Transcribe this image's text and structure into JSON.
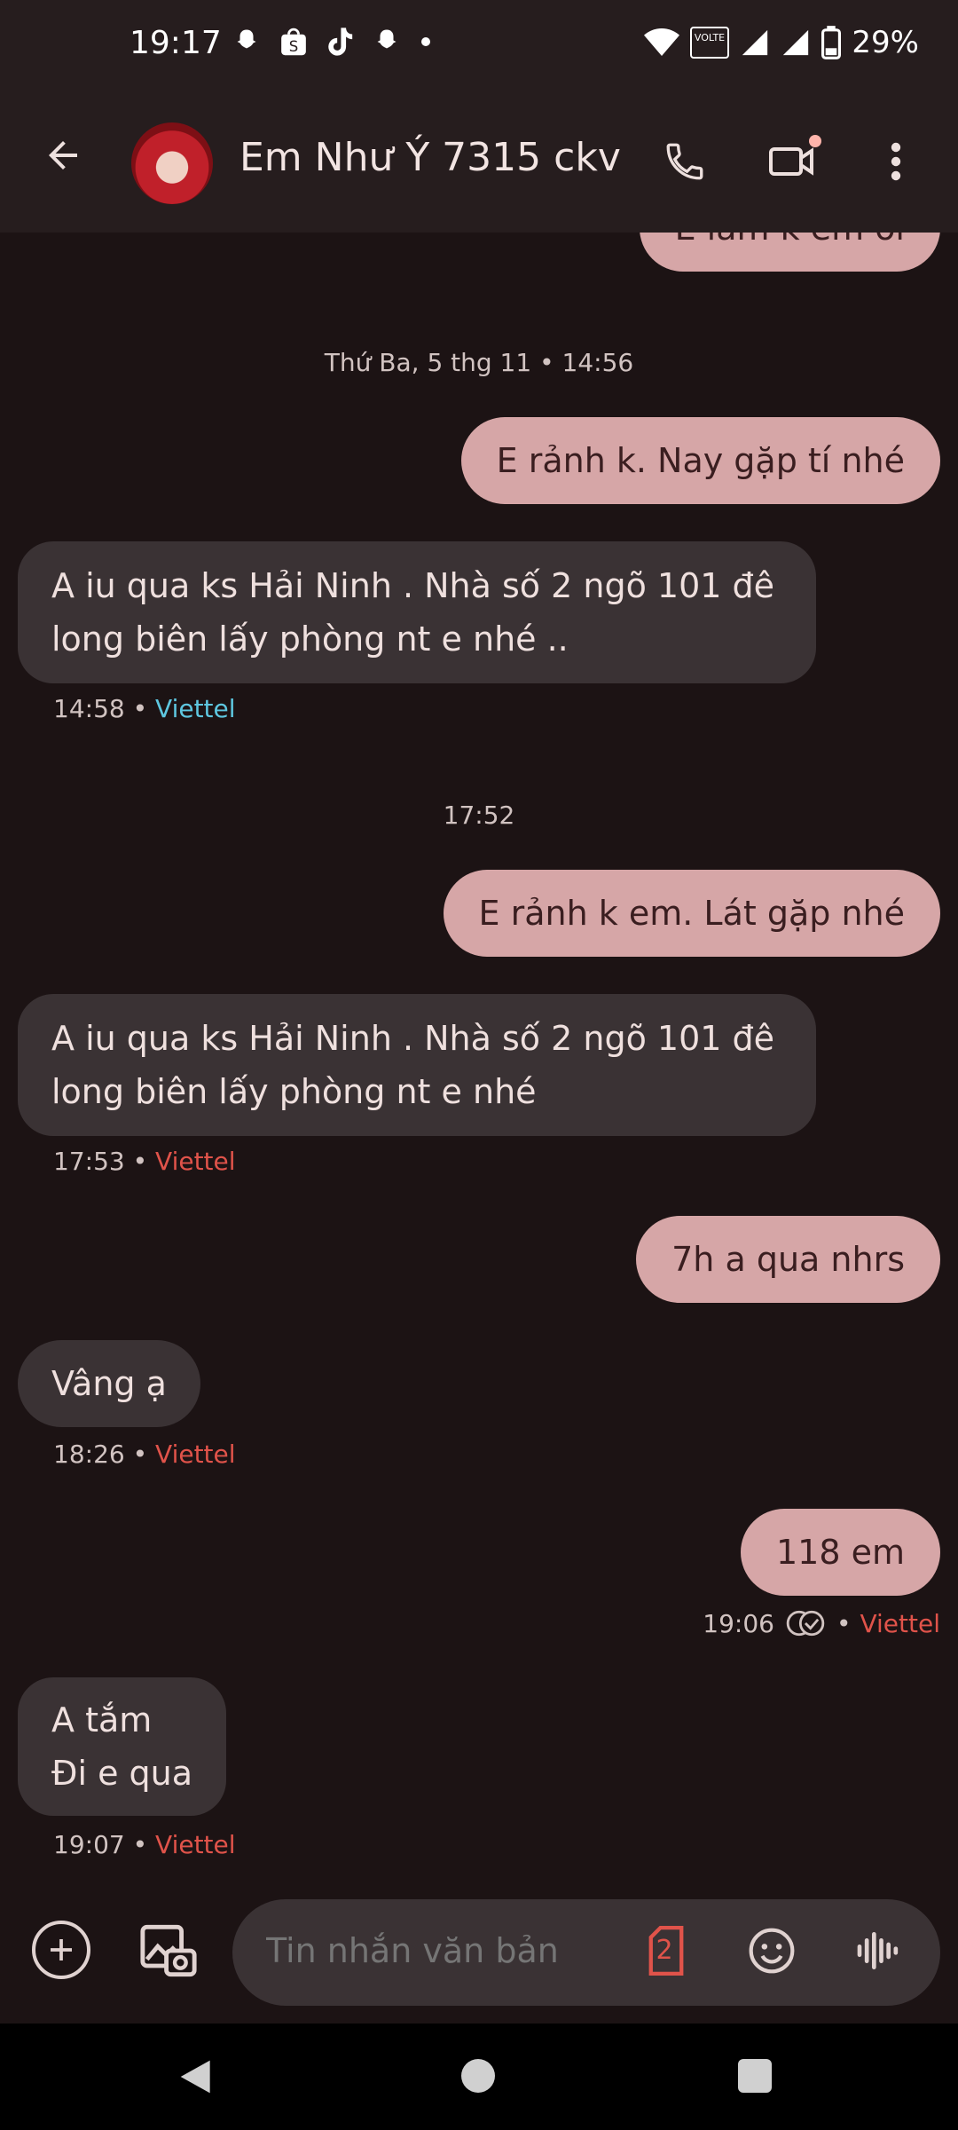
{
  "status_bar": {
    "time": "19:17",
    "battery": "29%",
    "network_label": "VOLTE",
    "notification_icons": [
      "snapchat-icon",
      "shopee-icon",
      "tiktok-icon",
      "snapchat-icon",
      "dot-icon"
    ]
  },
  "header": {
    "contact_name": "Em Như Ý 7315 ckv",
    "icons": [
      "back-arrow-icon",
      "phone-icon",
      "video-call-icon",
      "more-vert-icon"
    ]
  },
  "conversation": {
    "partial_top_text": "E làm k em ơi",
    "date_separator_1": "Thứ Ba, 5 thg 11 • 14:56",
    "msg1_out": "E rảnh k. Nay gặp tí nhé",
    "msg2_in": "A iu qua ks Hải Ninh . Nhà số 2 ngõ 101 đê long biên lấy phòng nt e nhé ..",
    "msg2_time": "14:58",
    "msg2_carrier": "Viettel",
    "time_separator_2": "17:52",
    "msg3_out": "E rảnh k em. Lát gặp nhé",
    "msg4_in": "A iu qua ks Hải Ninh . Nhà số 2 ngõ 101 đê long biên lấy phòng nt e nhé",
    "msg4_time": "17:53",
    "msg4_carrier": "Viettel",
    "msg5_out": "7h a qua nhrs",
    "msg6_in": "Vâng ạ",
    "msg6_time": "18:26",
    "msg6_carrier": "Viettel",
    "msg7_out": "118 em",
    "msg7_time": "19:06",
    "msg7_carrier": "Viettel",
    "msg8_in_line1": "A tắm",
    "msg8_in_line2": "Đi e qua",
    "msg8_time": "19:07",
    "msg8_carrier": "Viettel",
    "separator_dot": "•"
  },
  "composer": {
    "placeholder": "Tin nhắn văn bản",
    "sim_number": "2"
  },
  "colors": {
    "background": "#1c1314",
    "outgoing_bubble": "#d6a6a7",
    "incoming_bubble": "#3a3234",
    "carrier_blue": "#5ec7e0",
    "carrier_red": "#e0534a"
  }
}
